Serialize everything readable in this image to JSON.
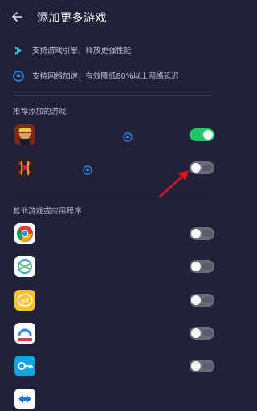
{
  "header": {
    "title": "添加更多游戏",
    "back_icon": "back-arrow-icon"
  },
  "features": [
    {
      "icon": "game-engine-icon",
      "text": "支持游戏引擎，释放更强性能"
    },
    {
      "icon": "network-accelerate-icon",
      "text": "支持网络加速，有效降低80%以上网络延迟"
    }
  ],
  "sections": {
    "recommended_title": "推荐添加的游戏",
    "others_title": "其他游戏或应用程序"
  },
  "recommended": [
    {
      "app": "game-1",
      "icon": "onepiece-game-icon",
      "badge": "network-accelerate-badge-icon",
      "enabled": true
    },
    {
      "app": "game-2",
      "icon": "wuxia-game-icon",
      "badge": "network-accelerate-badge-icon",
      "enabled": false
    }
  ],
  "others": [
    {
      "app": "chrome",
      "icon": "chrome-icon",
      "enabled": false
    },
    {
      "app": "browser",
      "icon": "browser-icon",
      "enabled": false
    },
    {
      "app": "gif",
      "icon": "gif-icon",
      "icon_text": "gif",
      "enabled": false
    },
    {
      "app": "cloud",
      "icon": "cloud-app-icon",
      "enabled": false
    },
    {
      "app": "key",
      "icon": "key-app-icon",
      "enabled": false
    },
    {
      "app": "remote",
      "icon": "remote-app-icon",
      "enabled": false
    }
  ],
  "colors": {
    "background": "#21223a",
    "toggle_on": "#25c466",
    "toggle_off": "#6a6b79",
    "accent": "#2f8ef0",
    "arrow": "#e0151a"
  }
}
